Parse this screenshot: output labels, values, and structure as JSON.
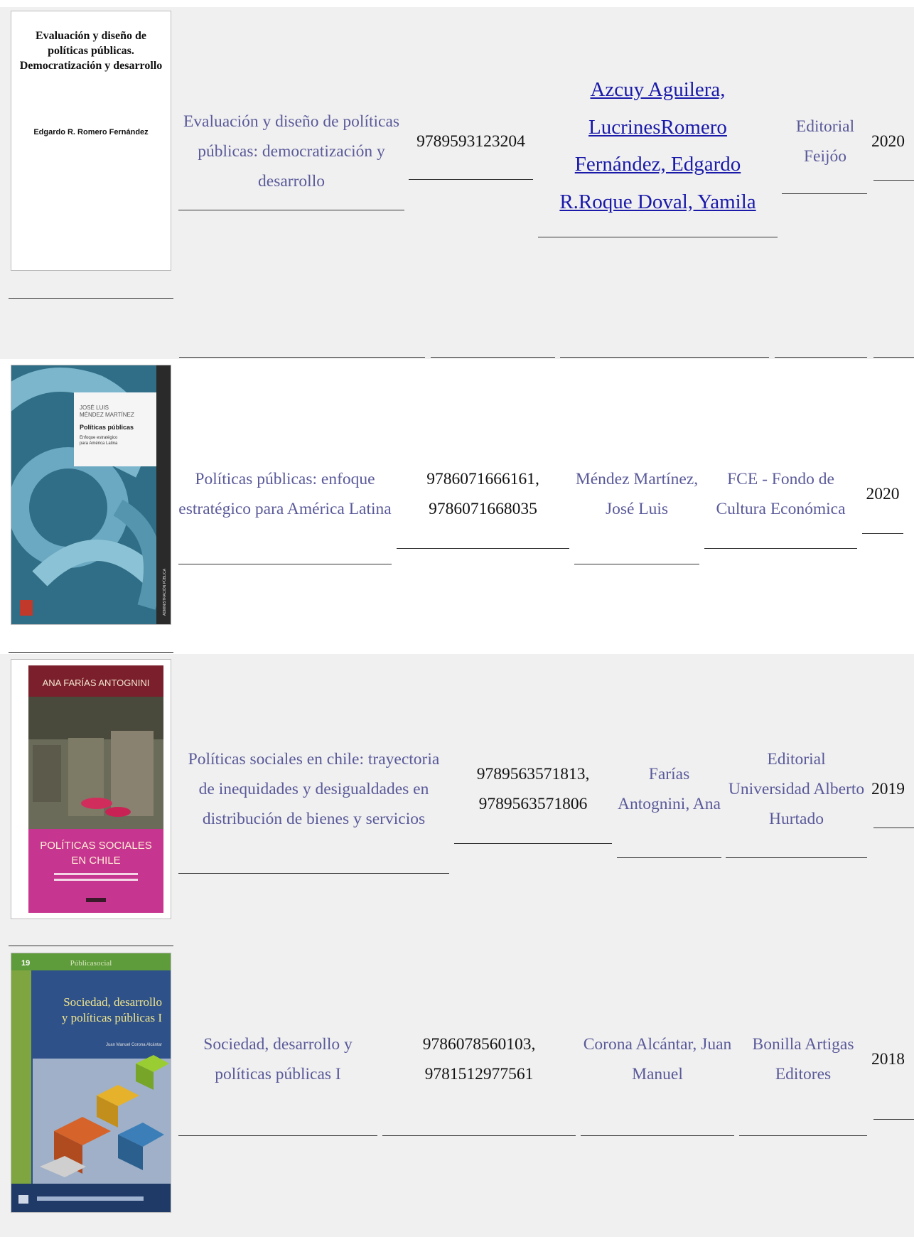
{
  "rows": [
    {
      "cover": {
        "title_lines": [
          "Evaluación y diseño de",
          "políticas públicas.",
          "Democratización y desarrollo"
        ],
        "author": "Edgardo R. Romero Fernández"
      },
      "title": "Evaluación y diseño de políticas públicas: democratización y desarrollo",
      "isbn": "9789593123204",
      "author_lines": [
        "Azcuy Aguilera,",
        "LucrinesRomero",
        "Fernández, Edgardo",
        "R.Roque Doval, Yamila"
      ],
      "publisher": "Editorial Feijóo",
      "year": "2020"
    },
    {
      "cover": {
        "author_lines": [
          "JOSÉ LUIS",
          "MÉNDEZ MARTÍNEZ"
        ],
        "title": "Políticas públicas",
        "subtitle_lines": [
          "Enfoque estratégico",
          "para América Latina"
        ],
        "spine": "ADMINISTRACIÓN PÚBLICA"
      },
      "title": "Políticas públicas: enfoque estratégico para América Latina",
      "isbn_lines": [
        "9786071666161,",
        "9786071668035"
      ],
      "author": "Méndez Martínez, José Luis",
      "publisher": "FCE - Fondo de Cultura Económica",
      "year": "2020"
    },
    {
      "cover": {
        "author": "ANA FARÍAS ANTOGNINI",
        "title_lines": [
          "POLÍTICAS SOCIALES",
          "EN CHILE"
        ]
      },
      "title": "Políticas sociales en chile: trayectoria de inequidades y desigualdades en distribución de bienes y servicios",
      "isbn_lines": [
        "9789563571813,",
        "9789563571806"
      ],
      "author": "Farías Antognini, Ana",
      "publisher": "Editorial Universidad Alberto Hurtado",
      "year": "2019"
    },
    {
      "cover": {
        "number": "19",
        "series": "Públicasocial",
        "title_lines": [
          "Sociedad, desarrollo",
          "y políticas públicas I"
        ],
        "editor": "Juan Manuel Corona Alcántar"
      },
      "title": "Sociedad, desarrollo y políticas públicas I",
      "isbn_lines": [
        "9786078560103,",
        "9781512977561"
      ],
      "author": "Corona Alcántar, Juan Manuel",
      "publisher": "Bonilla Artigas Editores",
      "year": "2018"
    }
  ]
}
